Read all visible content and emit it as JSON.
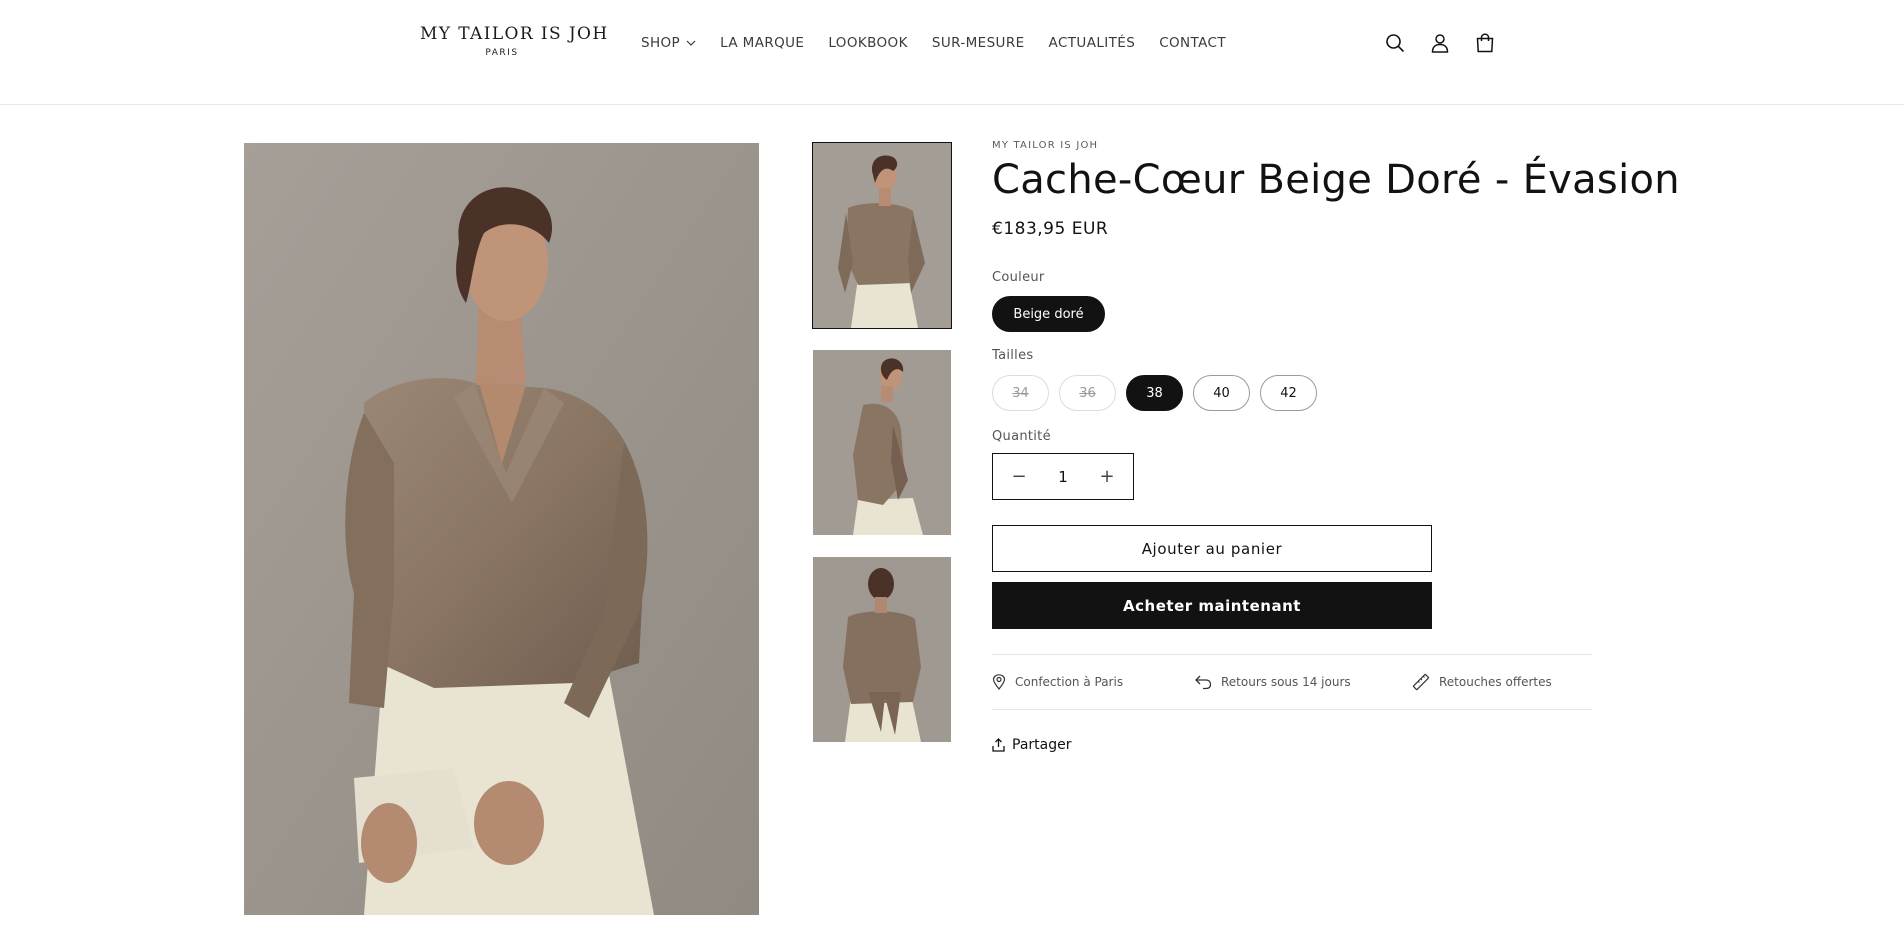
{
  "header": {
    "logo_main": "MY TAILOR IS JOH",
    "logo_sub": "PARIS",
    "nav": [
      "SHOP",
      "LA MARQUE",
      "LOOKBOOK",
      "SUR-MESURE",
      "ACTUALITÉS",
      "CONTACT"
    ],
    "icons": [
      "search-icon",
      "account-icon",
      "cart-icon"
    ]
  },
  "product": {
    "vendor": "MY TAILOR IS JOH",
    "title": "Cache-Cœur Beige Doré - Évasion",
    "price": "€183,95 EUR",
    "color_label": "Couleur",
    "color_value": "Beige doré",
    "size_label": "Tailles",
    "sizes": [
      {
        "label": "34",
        "state": "unavailable"
      },
      {
        "label": "36",
        "state": "unavailable"
      },
      {
        "label": "38",
        "state": "selected"
      },
      {
        "label": "40",
        "state": "available"
      },
      {
        "label": "42",
        "state": "available"
      }
    ],
    "quantity_label": "Quantité",
    "quantity": "1",
    "quantity_minus": "−",
    "quantity_plus": "+",
    "add_to_cart": "Ajouter au panier",
    "buy_now": "Acheter maintenant",
    "features": [
      {
        "icon": "pin-icon",
        "label": "Confection à Paris"
      },
      {
        "icon": "return-icon",
        "label": "Retours sous 14 jours"
      },
      {
        "icon": "ruler-icon",
        "label": "Retouches offertes"
      }
    ],
    "share": "Partager"
  },
  "colors": {
    "text": "#121212",
    "background": "#ffffff",
    "photo_background": "#a09a93",
    "blouse": "#8c7866",
    "skirt": "#e9e4d2"
  }
}
